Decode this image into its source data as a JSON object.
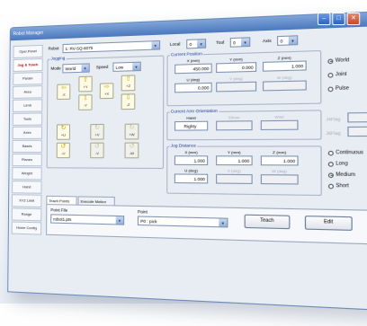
{
  "window": {
    "title": "Robot Manager",
    "controls": [
      "–",
      "□",
      "✕"
    ]
  },
  "sidebar": {
    "items": [
      {
        "label": "Oper.Panel",
        "selected": false
      },
      {
        "label": "Jog & Teach",
        "selected": true
      },
      {
        "label": "Param",
        "selected": false
      },
      {
        "label": "Area",
        "selected": false
      },
      {
        "label": "Limit",
        "selected": false
      },
      {
        "label": "Tools",
        "selected": false
      },
      {
        "label": "Axes",
        "selected": false
      },
      {
        "label": "Bases",
        "selected": false
      },
      {
        "label": "Planes",
        "selected": false
      },
      {
        "label": "Weight",
        "selected": false
      },
      {
        "label": "Hand",
        "selected": false
      },
      {
        "label": "XYZ Limit",
        "selected": false
      },
      {
        "label": "Range",
        "selected": false
      },
      {
        "label": "Home Config",
        "selected": false
      }
    ]
  },
  "robot": {
    "label": "Robot",
    "value": "1: RV-SQ-6075"
  },
  "local": {
    "label": "Local",
    "value": "0"
  },
  "tool": {
    "label": "Tool",
    "value": "0"
  },
  "axis": {
    "label": "Axis",
    "value": "0"
  },
  "jogging": {
    "title": "Jogging",
    "mode_label": "Mode",
    "mode_value": "World",
    "speed_label": "Speed",
    "speed_value": "Low",
    "buttons": [
      {
        "label": "+Y",
        "name": "jog-plus-y-button"
      },
      {
        "label": "+X",
        "name": "jog-plus-x-button"
      },
      {
        "label": "+Z",
        "name": "jog-plus-z-button"
      },
      {
        "label": "-X",
        "name": "jog-minus-x-button"
      },
      {
        "label": "-Y",
        "name": "jog-minus-y-button"
      },
      {
        "label": "-Z",
        "name": "jog-minus-z-button"
      },
      {
        "label": "+U",
        "name": "jog-plus-u-button"
      },
      {
        "label": "+V",
        "name": "jog-plus-v-button"
      },
      {
        "label": "+W",
        "name": "jog-plus-w-button"
      },
      {
        "label": "-U",
        "name": "jog-minus-u-button"
      },
      {
        "label": "-V",
        "name": "jog-minus-v-button"
      },
      {
        "label": "-W",
        "name": "jog-minus-w-button"
      }
    ]
  },
  "current_position": {
    "title": "Current Position",
    "x": {
      "label": "X (mm)",
      "value": "450.000"
    },
    "y": {
      "label": "Y (mm)",
      "value": "0.000"
    },
    "z": {
      "label": "Z (mm)",
      "value": "1.000"
    },
    "u": {
      "label": "U (deg)",
      "value": "0.000"
    },
    "v": {
      "label": "V (deg)",
      "value": ""
    },
    "w": {
      "label": "W (deg)",
      "value": ""
    }
  },
  "coord_radios": [
    {
      "label": "World",
      "checked": true
    },
    {
      "label": "Joint",
      "checked": false
    },
    {
      "label": "Pulse",
      "checked": false
    }
  ],
  "arm_orientation": {
    "title": "Current Arm Orientation",
    "hand_label": "Hand",
    "hand_value": "Righty",
    "elbow_label": "Elbow",
    "wrist_label": "Wrist",
    "j4flag_label": "J4Flag",
    "j6flag_label": "J6Flag"
  },
  "jog_distance": {
    "title": "Jog Distance",
    "x": {
      "label": "X (mm)",
      "value": "1.000"
    },
    "y": {
      "label": "Y (mm)",
      "value": "1.000"
    },
    "z": {
      "label": "Z (mm)",
      "value": "1.000"
    },
    "u": {
      "label": "U (deg)",
      "value": "1.000"
    },
    "v": {
      "label": "V (deg)",
      "value": ""
    },
    "w": {
      "label": "W (deg)",
      "value": ""
    }
  },
  "distance_radios": [
    {
      "label": "Continuous",
      "checked": false
    },
    {
      "label": "Long",
      "checked": false
    },
    {
      "label": "Medium",
      "checked": true
    },
    {
      "label": "Short",
      "checked": false
    }
  ],
  "tabs": [
    {
      "label": "Teach Points"
    },
    {
      "label": "Execute Motion"
    }
  ],
  "point_file": {
    "label": "Point File",
    "value": "robot1.pts"
  },
  "point": {
    "label": "Point",
    "value": "P0 : pick"
  },
  "teach_button": {
    "label": "Teach"
  },
  "edit_button": {
    "label": "Edit"
  }
}
